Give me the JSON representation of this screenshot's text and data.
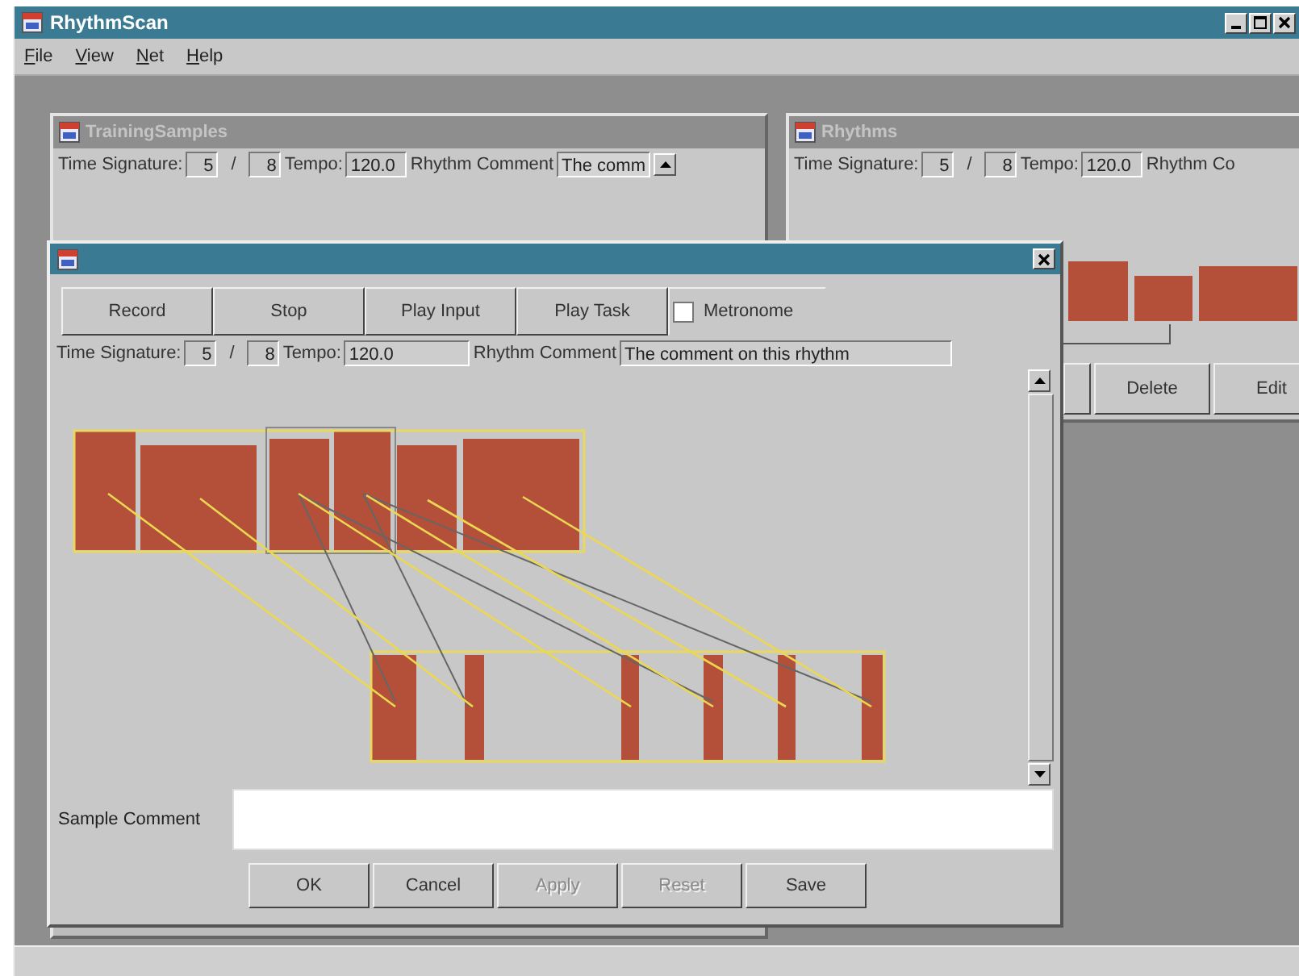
{
  "window": {
    "title": "RhythmScan"
  },
  "menu": [
    {
      "label": "File"
    },
    {
      "label": "View"
    },
    {
      "label": "Net"
    },
    {
      "label": "Help"
    }
  ],
  "training_samples": {
    "title": "TrainingSamples",
    "time_signature_label": "Time Signature:",
    "numerator": "5",
    "slash": "/",
    "denominator": "8",
    "tempo_label": "Tempo:",
    "tempo": "120.0",
    "comment_label": "Rhythm Comment",
    "comment": "The comm"
  },
  "rhythms": {
    "title": "Rhythms",
    "time_signature_label": "Time Signature:",
    "numerator": "5",
    "slash": "/",
    "denominator": "8",
    "tempo_label": "Tempo:",
    "tempo": "120.0",
    "comment_label": "Rhythm Co",
    "buttons": [
      {
        "label": "Delete"
      },
      {
        "label": "Edit"
      }
    ]
  },
  "dialog": {
    "toolbar": [
      {
        "label": "Record"
      },
      {
        "label": "Stop"
      },
      {
        "label": "Play Input"
      },
      {
        "label": "Play Task"
      }
    ],
    "metronome": {
      "label": "Metronome",
      "checked": false
    },
    "time_signature_label": "Time Signature:",
    "numerator": "5",
    "slash": "/",
    "denominator": "8",
    "tempo_label": "Tempo:",
    "tempo": "120.0",
    "comment_label": "Rhythm Comment",
    "comment": "The comment on this rhythm",
    "sample_comment_label": "Sample Comment",
    "buttons": [
      {
        "label": "OK",
        "disabled": false
      },
      {
        "label": "Cancel",
        "disabled": false
      },
      {
        "label": "Apply",
        "disabled": true
      },
      {
        "label": "Reset",
        "disabled": true
      },
      {
        "label": "Save",
        "disabled": false
      }
    ]
  }
}
